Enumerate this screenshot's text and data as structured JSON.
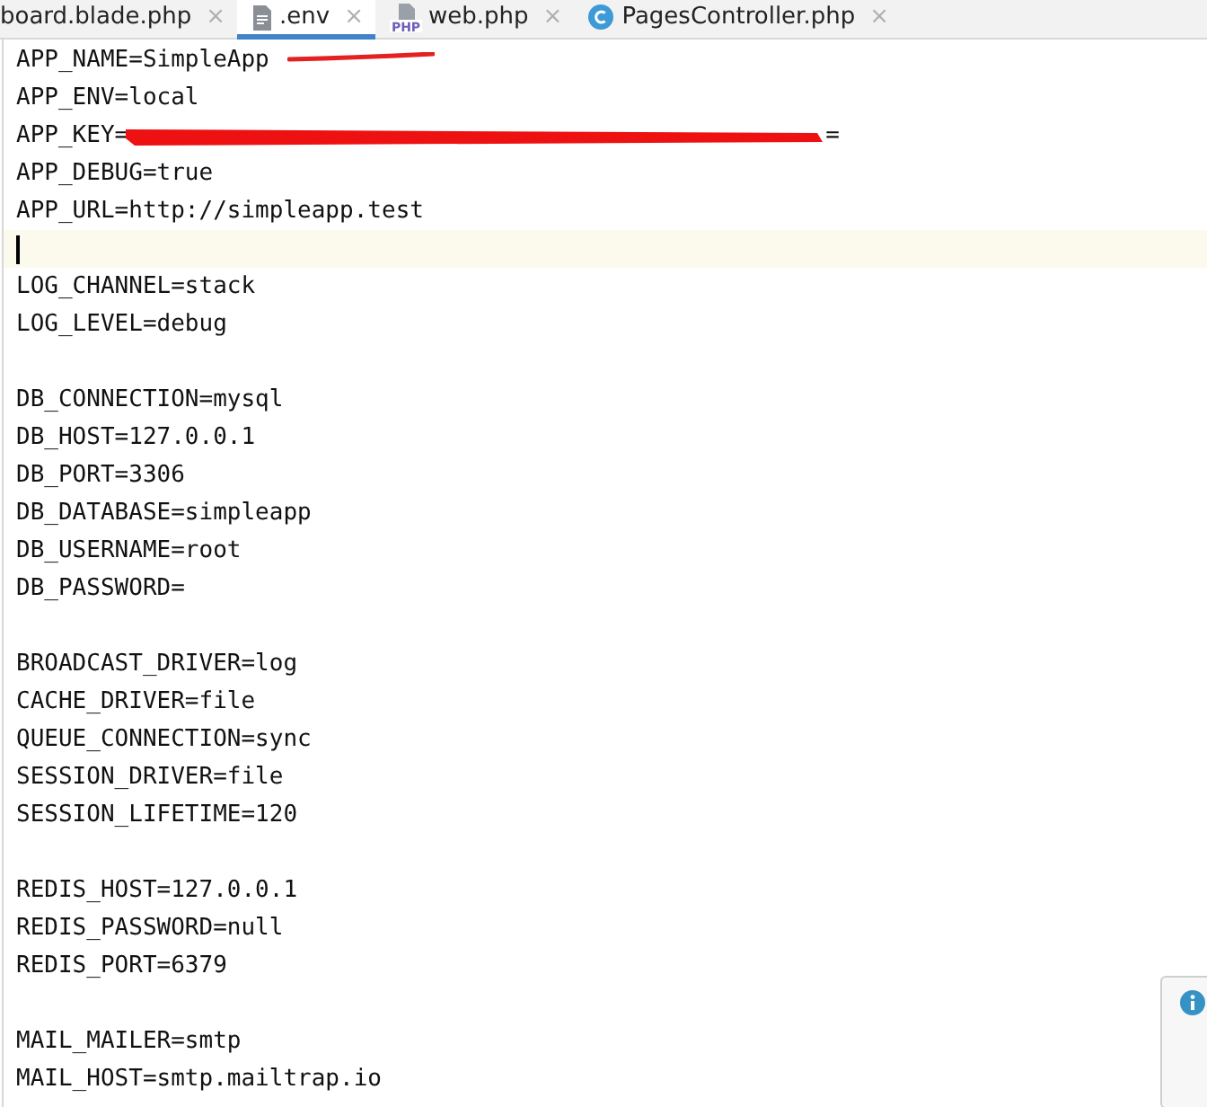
{
  "tabs": [
    {
      "label": "board.blade.php",
      "kind": "plain",
      "selected": false,
      "close": "×"
    },
    {
      "label": ".env",
      "kind": "file",
      "selected": true,
      "close": "×"
    },
    {
      "label": "web.php",
      "kind": "php",
      "icon_text": "PHP",
      "selected": false,
      "close": "×"
    },
    {
      "label": "PagesController.php",
      "kind": "class",
      "selected": false,
      "close": "×"
    }
  ],
  "editor": {
    "lines": [
      {
        "kind": "underlined",
        "text": "APP_NAME=SimpleApp"
      },
      {
        "kind": "text",
        "text": "APP_ENV=local"
      },
      {
        "kind": "redacted",
        "text": "APP_KEY=",
        "tail": "="
      },
      {
        "kind": "text",
        "text": "APP_DEBUG=true"
      },
      {
        "kind": "text",
        "text": "APP_URL=http://simpleapp.test"
      },
      {
        "kind": "caret"
      },
      {
        "kind": "text",
        "text": "LOG_CHANNEL=stack"
      },
      {
        "kind": "text",
        "text": "LOG_LEVEL=debug"
      },
      {
        "kind": "blank"
      },
      {
        "kind": "text",
        "text": "DB_CONNECTION=mysql"
      },
      {
        "kind": "text",
        "text": "DB_HOST=127.0.0.1"
      },
      {
        "kind": "text",
        "text": "DB_PORT=3306"
      },
      {
        "kind": "text",
        "text": "DB_DATABASE=simpleapp"
      },
      {
        "kind": "text",
        "text": "DB_USERNAME=root"
      },
      {
        "kind": "text",
        "text": "DB_PASSWORD="
      },
      {
        "kind": "blank"
      },
      {
        "kind": "text",
        "text": "BROADCAST_DRIVER=log"
      },
      {
        "kind": "text",
        "text": "CACHE_DRIVER=file"
      },
      {
        "kind": "text",
        "text": "QUEUE_CONNECTION=sync"
      },
      {
        "kind": "text",
        "text": "SESSION_DRIVER=file"
      },
      {
        "kind": "text",
        "text": "SESSION_LIFETIME=120"
      },
      {
        "kind": "blank"
      },
      {
        "kind": "text",
        "text": "REDIS_HOST=127.0.0.1"
      },
      {
        "kind": "text",
        "text": "REDIS_PASSWORD=null"
      },
      {
        "kind": "text",
        "text": "REDIS_PORT=6379"
      },
      {
        "kind": "blank"
      },
      {
        "kind": "text",
        "text": "MAIL_MAILER=smtp"
      },
      {
        "kind": "text",
        "text": "MAIL_HOST=smtp.mailtrap.io"
      }
    ]
  }
}
